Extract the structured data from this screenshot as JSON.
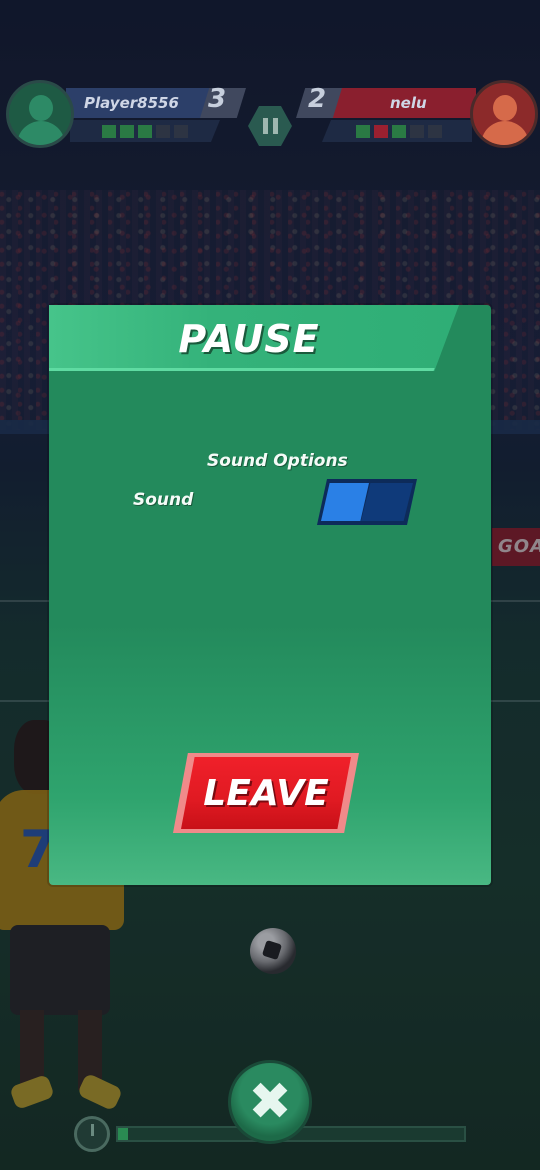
{
  "scoreboard": {
    "left_player": {
      "name": "Player8556",
      "score": "3",
      "pips": [
        "g",
        "g",
        "g",
        "n",
        "n"
      ],
      "avatar_icon": "player-avatar-icon"
    },
    "right_player": {
      "name": "nelu",
      "score": "2",
      "pips": [
        "g",
        "r",
        "g",
        "n",
        "n"
      ],
      "avatar_icon": "player-avatar-icon"
    },
    "pause_icon": "pause-icon"
  },
  "background": {
    "banner_text": "GOAL",
    "player_number": "7"
  },
  "pause_panel": {
    "title": "PAUSE",
    "section_title": "Sound Options",
    "sound_label": "Sound",
    "sound_enabled": true,
    "leave_label": "LEAVE"
  },
  "bottom": {
    "close_icon": "close-icon",
    "close_glyph": "✖",
    "timer_icon": "timer-icon",
    "progress": 0.03
  },
  "colors": {
    "panel": "#238a5c",
    "panel_header": "#34b27a",
    "toggle_on": "#2a80e6",
    "toggle_off": "#0f3a7a",
    "leave_button": "#e01a22"
  }
}
